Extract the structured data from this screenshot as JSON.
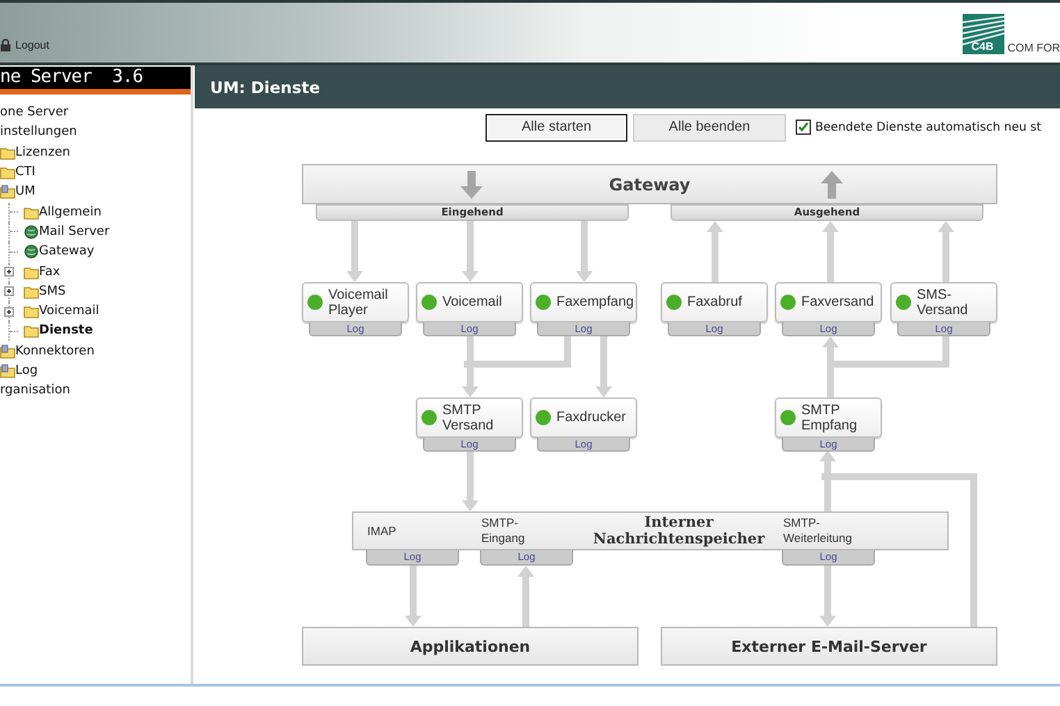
{
  "header": {
    "logout": "Logout",
    "logo_mark": "C4B",
    "logo_text": "COM FOR"
  },
  "sidebar": {
    "title": "ne Server  3.6",
    "tree": [
      {
        "label": "one Server",
        "selected": false,
        "children": [
          {
            "label": "instellungen",
            "selected": false,
            "children": [
              {
                "label": "Lizenzen",
                "kind": "folder",
                "selected": false
              },
              {
                "label": "CTI",
                "kind": "folder",
                "selected": false
              },
              {
                "label": "UM",
                "kind": "document",
                "selected": false,
                "children": [
                  {
                    "label": "Allgemein",
                    "kind": "folder",
                    "selected": false
                  },
                  {
                    "label": "Mail Server",
                    "kind": "globe",
                    "selected": false
                  },
                  {
                    "label": "Gateway",
                    "kind": "globe",
                    "selected": false
                  },
                  {
                    "label": "Fax",
                    "kind": "folder",
                    "selected": false,
                    "expanded": false
                  },
                  {
                    "label": "SMS",
                    "kind": "folder",
                    "selected": false,
                    "expanded": false
                  },
                  {
                    "label": "Voicemail",
                    "kind": "folder",
                    "selected": false,
                    "expanded": false
                  },
                  {
                    "label": "Dienste",
                    "kind": "folder",
                    "selected": true
                  }
                ]
              },
              {
                "label": "Konnektoren",
                "kind": "document",
                "selected": false
              },
              {
                "label": "Log",
                "kind": "document",
                "selected": false
              }
            ]
          },
          {
            "label": "rganisation",
            "selected": false
          }
        ]
      }
    ]
  },
  "main": {
    "title": "UM: Dienste",
    "buttons": [
      {
        "label": "Alle starten",
        "focused": true
      },
      {
        "label": "Alle beenden",
        "focused": false
      }
    ],
    "auto_restart": {
      "label": "Beendete Dienste automatisch neu st",
      "checked": true
    },
    "diagram": {
      "gateway": {
        "title": "Gateway",
        "incoming": "Eingehend",
        "outgoing": "Ausgehend"
      },
      "services": [
        {
          "name": "Voicemail Player",
          "color": "#4caf2a",
          "log": "Log"
        },
        {
          "name": "Voicemail",
          "color": "#4caf2a",
          "log": "Log"
        },
        {
          "name": "Faxempfang",
          "color": "#4caf2a",
          "log": "Log"
        },
        {
          "name": "Faxabruf",
          "color": "#4caf2a",
          "log": "Log"
        },
        {
          "name": "Faxversand",
          "color": "#4caf2a",
          "log": "Log"
        },
        {
          "name": "SMS-Versand",
          "color": "#4caf2a",
          "log": "Log"
        },
        {
          "name": "SMTP Versand",
          "color": "#4caf2a",
          "log": "Log"
        },
        {
          "name": "Faxdrucker",
          "color": "#4caf2a",
          "log": "Log"
        },
        {
          "name": "SMTP Empfang",
          "color": "#4caf2a",
          "log": "Log"
        }
      ],
      "store": {
        "title": "Interner Nachrichtenspeicher",
        "endpoints": [
          {
            "name": "IMAP",
            "log": "Log"
          },
          {
            "name": "SMTP-Eingang",
            "log": "Log"
          },
          {
            "name": "SMTP-Weiterleitung",
            "log": "Log"
          }
        ]
      },
      "targets": [
        "Applikationen",
        "Externer E-Mail-Server"
      ]
    }
  }
}
